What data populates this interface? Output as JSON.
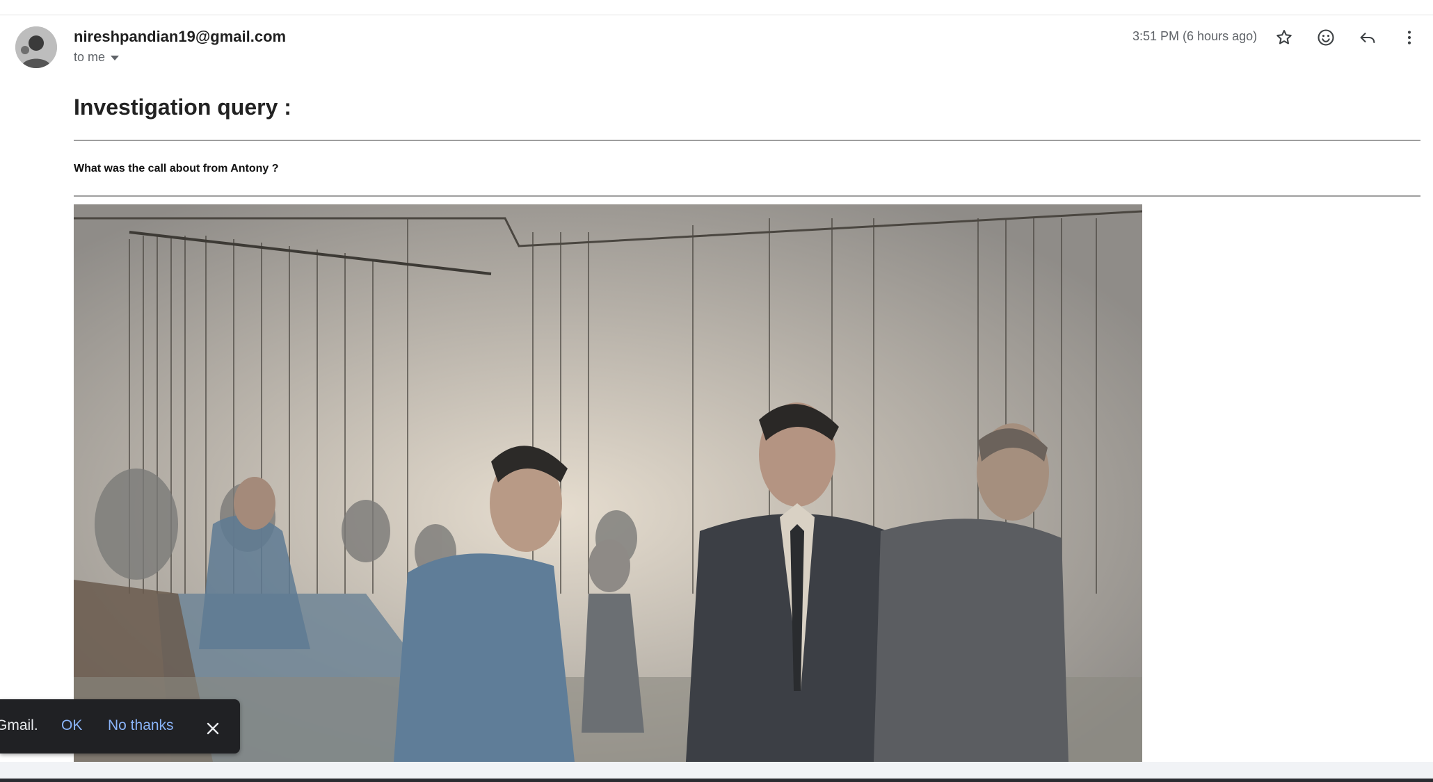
{
  "message": {
    "sender": "nireshpandian19@gmail.com",
    "recipient_label": "to me",
    "time": "3:51 PM (6 hours ago)",
    "title": "Investigation query :",
    "question": "What was the call about from Antony ?"
  },
  "header_icons": [
    "star-icon",
    "emoji-icon",
    "reply-icon",
    "more-vert-icon"
  ],
  "snackbar": {
    "text": "Gmail.",
    "ok_label": "OK",
    "no_label": "No thanks"
  },
  "colors": {
    "link_blue": "#8ab4f8",
    "snackbar_bg": "#202124"
  }
}
